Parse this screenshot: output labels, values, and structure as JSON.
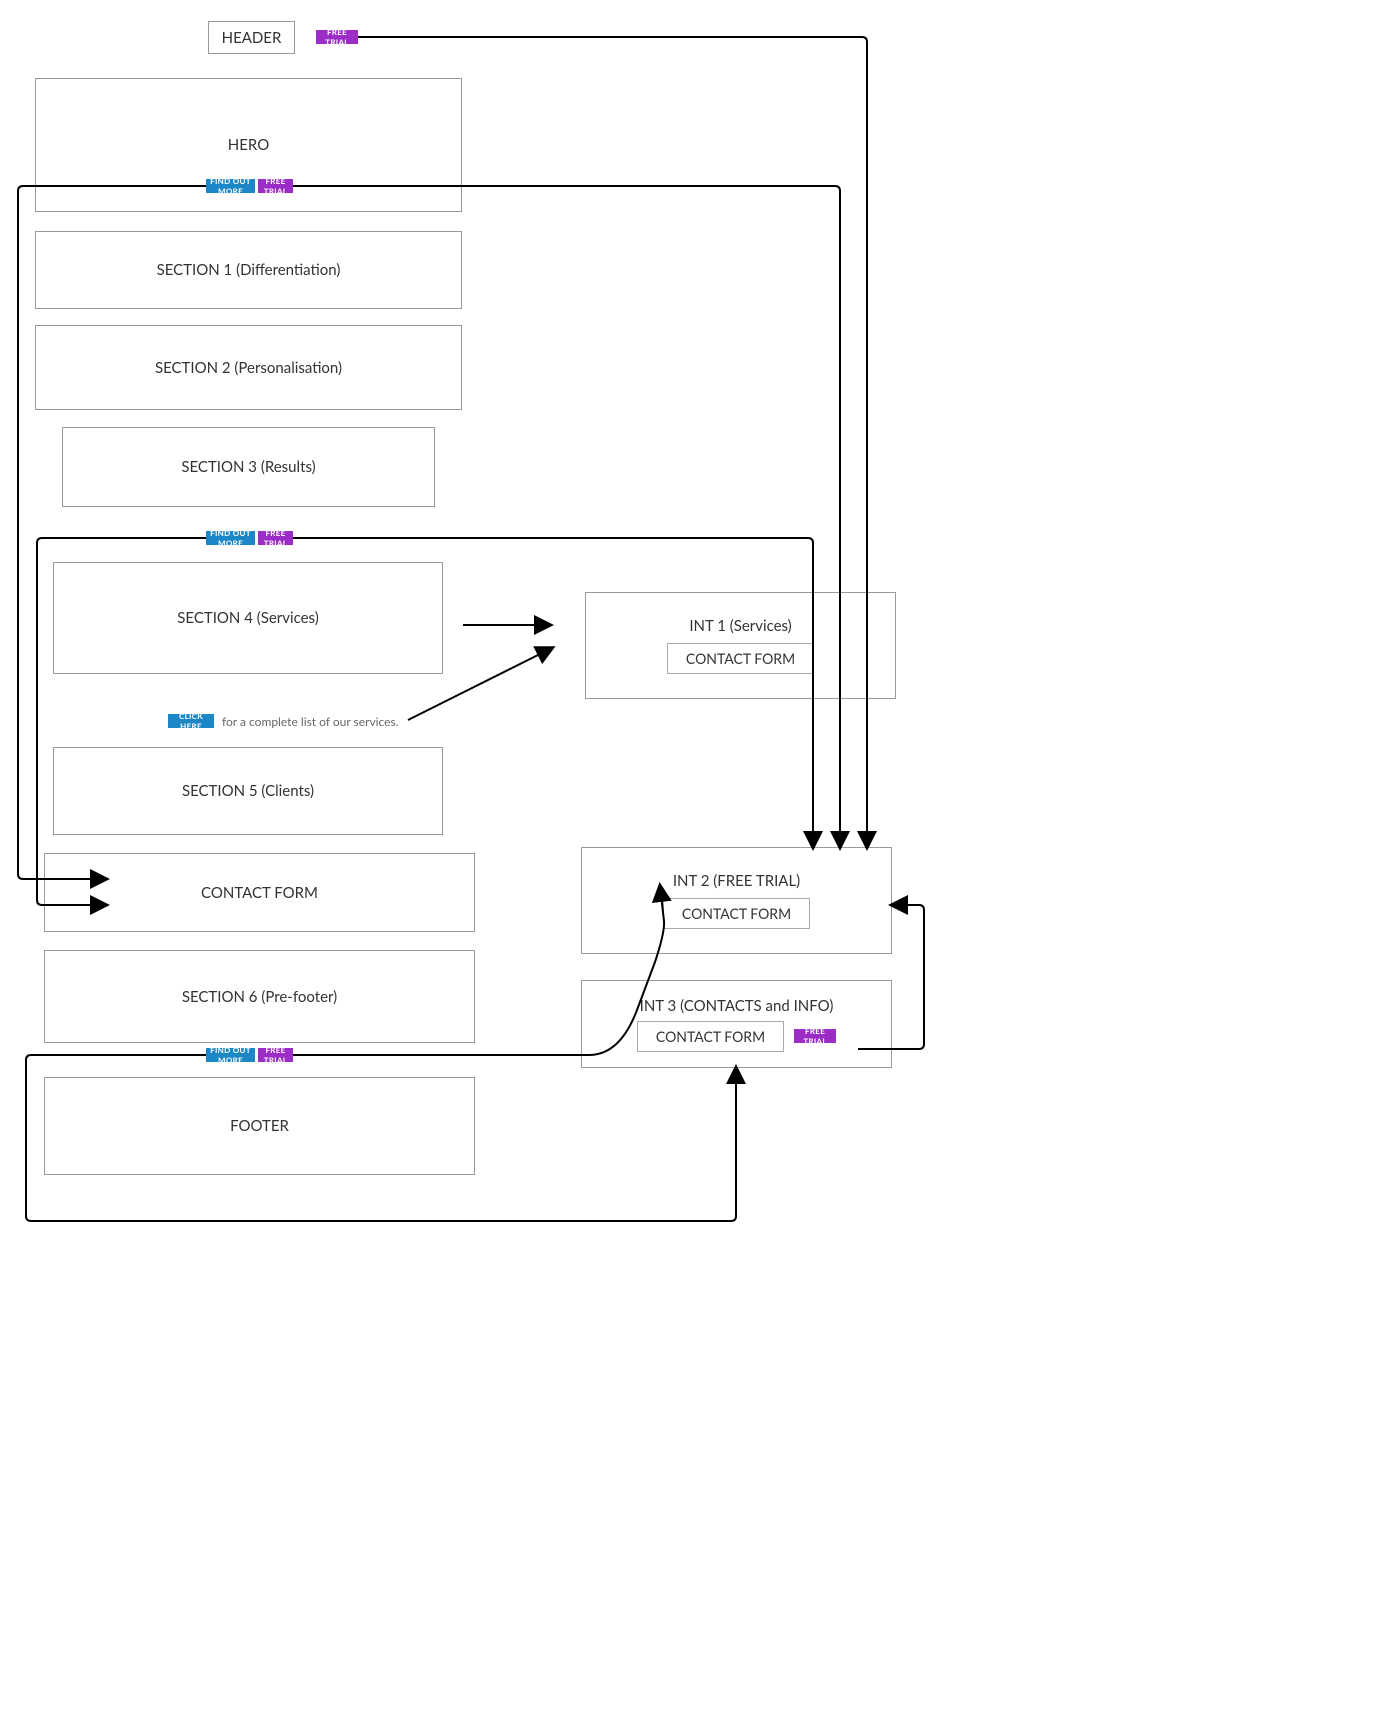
{
  "header": {
    "label": "HEADER"
  },
  "hero": {
    "label": "HERO"
  },
  "sections": {
    "s1": "SECTION 1 (Differentiation)",
    "s2": "SECTION 2 (Personalisation)",
    "s3": "SECTION 3 (Results)",
    "s4": "SECTION 4 (Services)",
    "s5": "SECTION 5 (Clients)",
    "s6": "SECTION 6 (Pre-footer)"
  },
  "contact_form": "CONTACT FORM",
  "footer": "FOOTER",
  "int1": {
    "title": "INT 1 (Services)"
  },
  "int2": {
    "title": "INT 2 (FREE TRIAL)"
  },
  "int3": {
    "title": "INT 3 (CONTACTS and INFO)"
  },
  "buttons": {
    "find_out_more": "FIND OUT MORE",
    "free_trial": "FREE TRIAL",
    "click_here": "CLICK HERE"
  },
  "click_here_caption": "for a complete list of our services.",
  "colors": {
    "blue": "#1B87C7",
    "magenta": "#9B2CC6"
  }
}
